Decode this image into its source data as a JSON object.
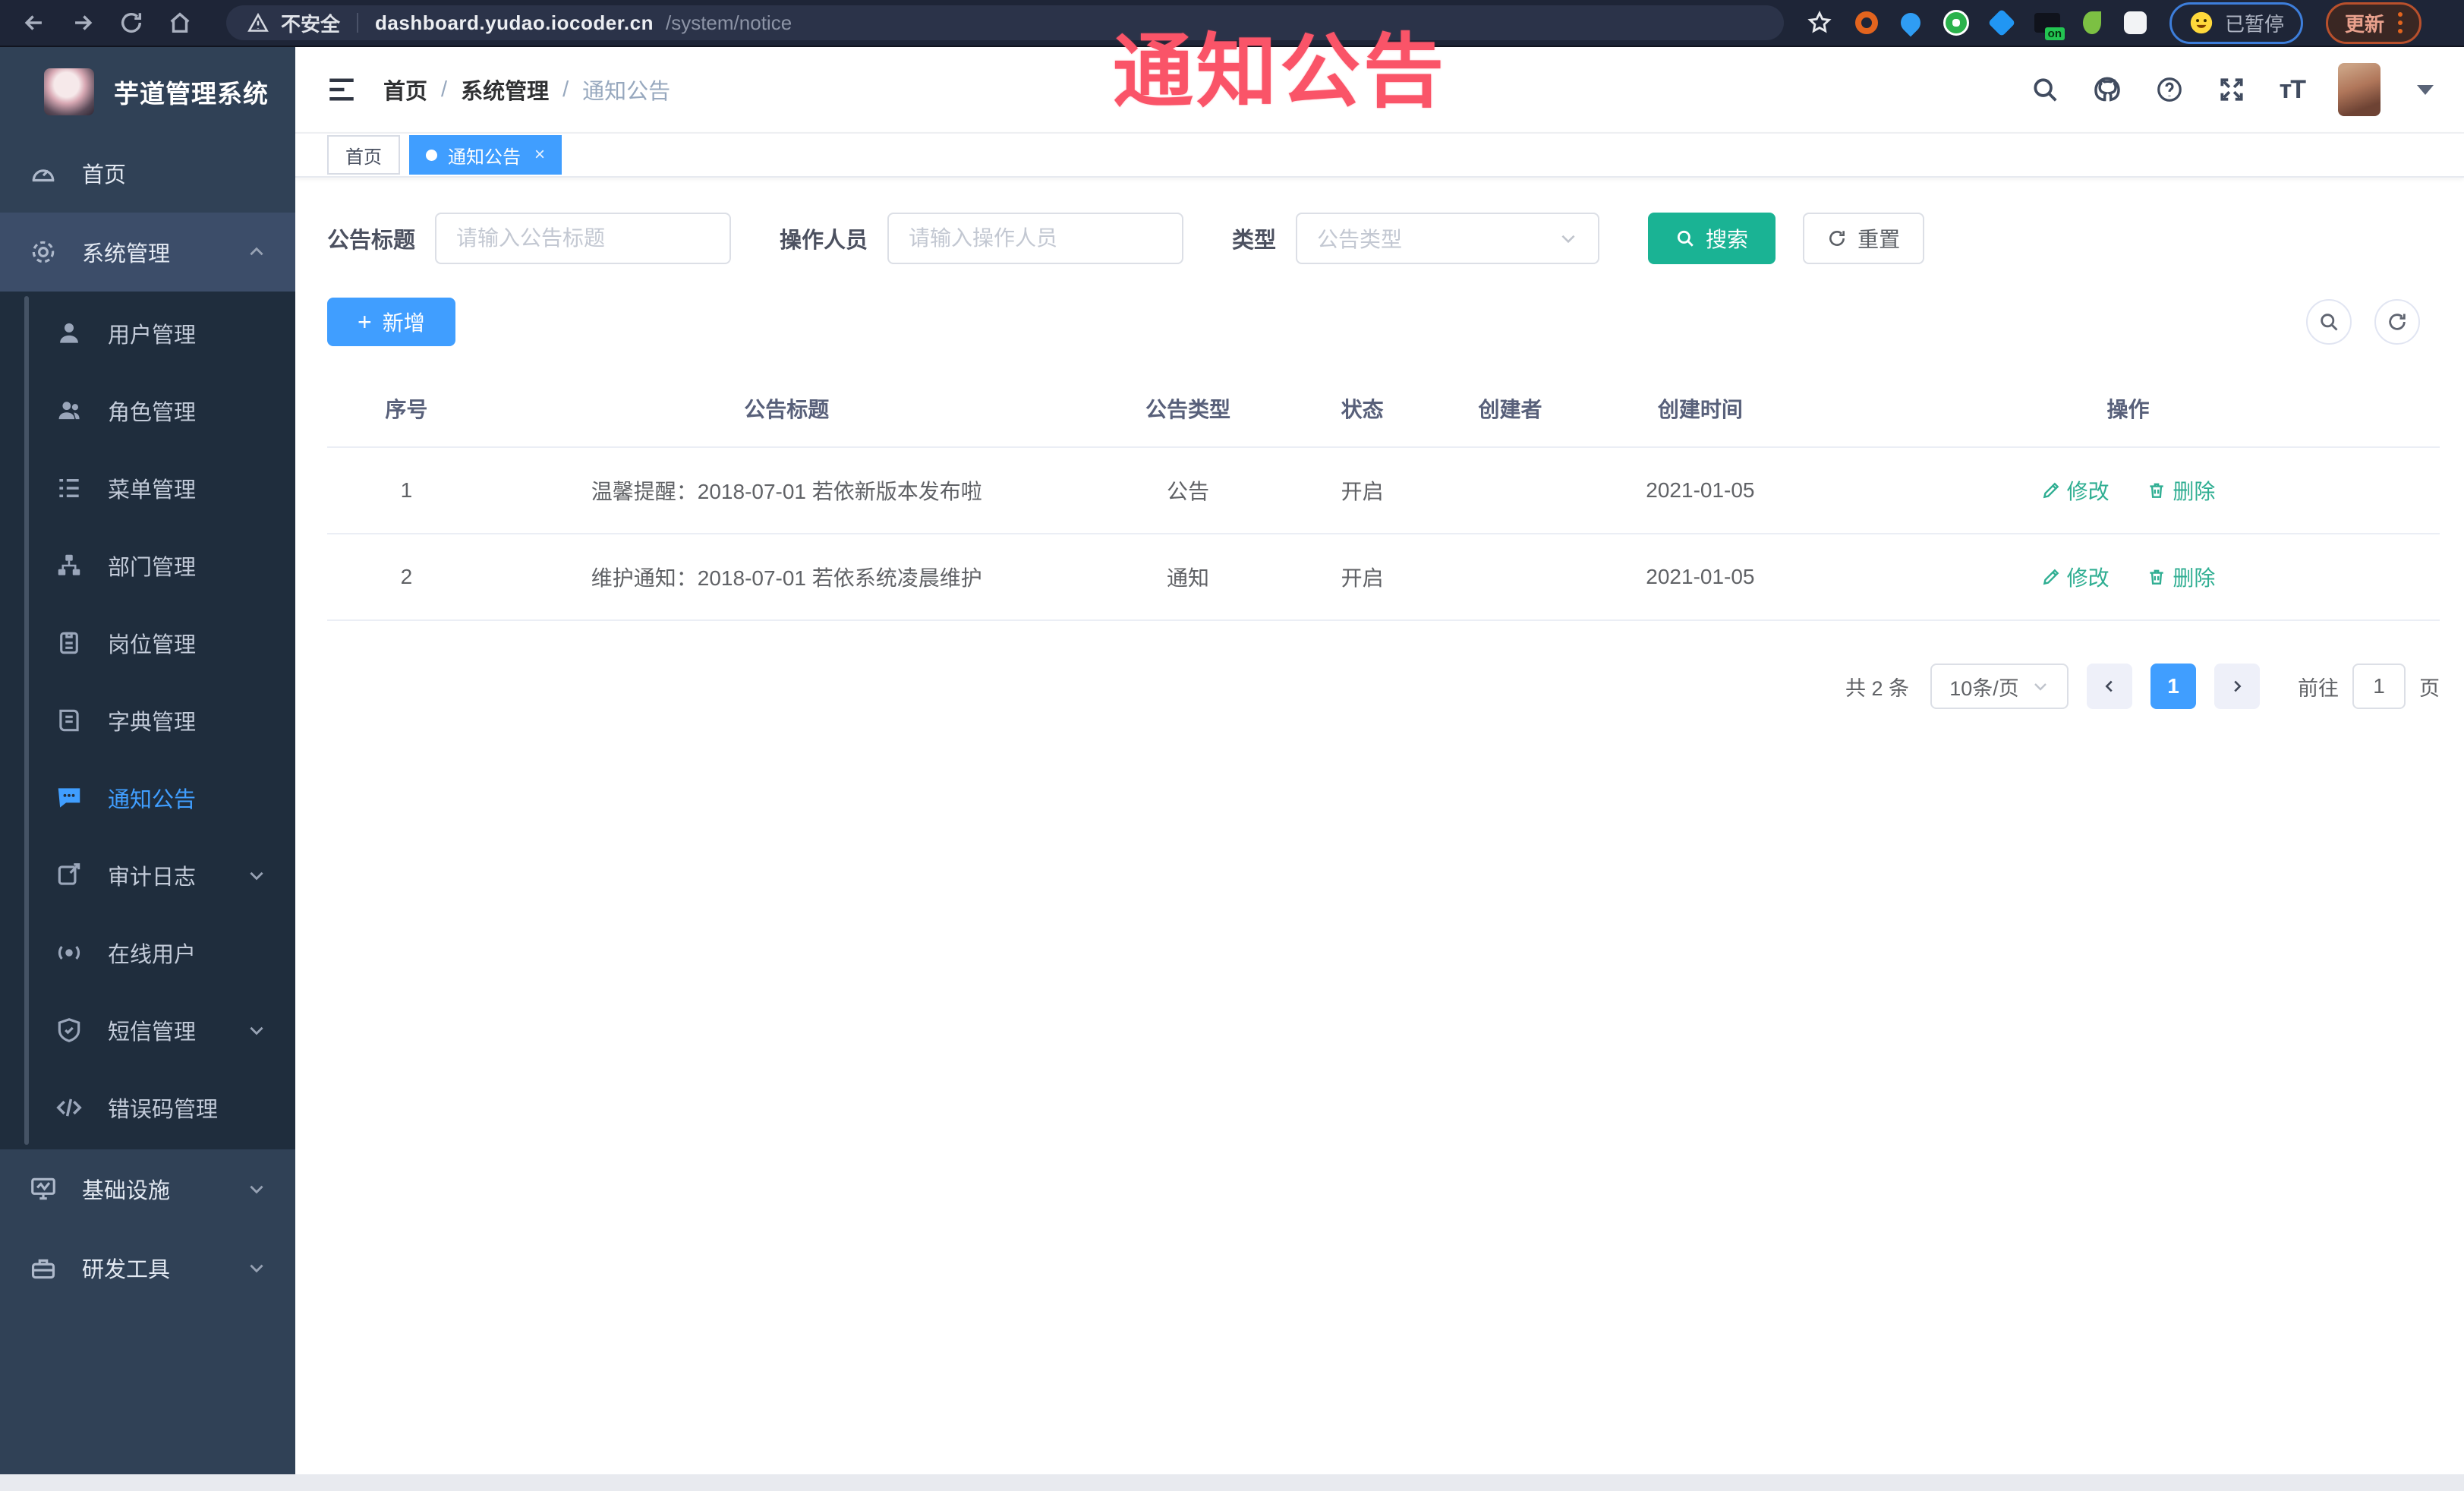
{
  "browser": {
    "security_label": "不安全",
    "url_host": "dashboard.yudao.iocoder.cn",
    "url_path": "/system/notice",
    "paused_chip_label": "已暂停",
    "update_button_label": "更新",
    "nav_icons": [
      "back-arrow",
      "forward-arrow",
      "reload",
      "home"
    ],
    "extension_icons": [
      "star",
      "orange-donut",
      "blue-pin",
      "green-circle",
      "blue-gem",
      "dark-stack-on",
      "green-sprout",
      "puzzle"
    ]
  },
  "watermark": "通知公告",
  "sidebar": {
    "title": "芋道管理系统",
    "items": [
      {
        "label": "首页",
        "icon": "dashboard-icon"
      },
      {
        "label": "系统管理",
        "icon": "gear-icon",
        "expanded": true
      },
      {
        "label": "用户管理",
        "icon": "user-icon"
      },
      {
        "label": "角色管理",
        "icon": "users-icon"
      },
      {
        "label": "菜单管理",
        "icon": "menu-list-icon"
      },
      {
        "label": "部门管理",
        "icon": "org-tree-icon"
      },
      {
        "label": "岗位管理",
        "icon": "badge-icon"
      },
      {
        "label": "字典管理",
        "icon": "book-icon"
      },
      {
        "label": "通知公告",
        "icon": "notice-icon",
        "active": true
      },
      {
        "label": "审计日志",
        "icon": "log-icon",
        "collapsible": true
      },
      {
        "label": "在线用户",
        "icon": "online-icon"
      },
      {
        "label": "短信管理",
        "icon": "shield-icon",
        "collapsible": true
      },
      {
        "label": "错误码管理",
        "icon": "code-icon"
      },
      {
        "label": "基础设施",
        "icon": "monitor-icon",
        "collapsible": true
      },
      {
        "label": "研发工具",
        "icon": "tools-icon",
        "collapsible": true
      }
    ]
  },
  "header": {
    "breadcrumb": [
      "首页",
      "系统管理",
      "通知公告"
    ],
    "separator": "/",
    "right_icons": [
      "search-icon",
      "github-icon",
      "help-icon",
      "fullscreen-icon",
      "font-size-icon"
    ],
    "font_size_glyph": "тT"
  },
  "tabs": [
    {
      "label": "首页",
      "active": false
    },
    {
      "label": "通知公告",
      "active": true,
      "close_glyph": "×"
    }
  ],
  "filters": {
    "title_label": "公告标题",
    "title_placeholder": "请输入公告标题",
    "operator_label": "操作人员",
    "operator_placeholder": "请输入操作人员",
    "type_label": "类型",
    "type_placeholder": "公告类型",
    "search_label": "搜索",
    "reset_label": "重置"
  },
  "toolbar": {
    "add_label": "新增",
    "plus_glyph": "+",
    "round_icons": [
      "search-icon",
      "refresh-icon"
    ]
  },
  "table": {
    "columns": [
      "序号",
      "公告标题",
      "公告类型",
      "状态",
      "创建者",
      "创建时间",
      "操作"
    ],
    "rows": [
      {
        "no": "1",
        "title": "温馨提醒：2018-07-01 若依新版本发布啦",
        "type": "公告",
        "status": "开启",
        "creator": "",
        "created": "2021-01-05"
      },
      {
        "no": "2",
        "title": "维护通知：2018-07-01 若依系统凌晨维护",
        "type": "通知",
        "status": "开启",
        "creator": "",
        "created": "2021-01-05"
      }
    ],
    "actions": {
      "edit": "修改",
      "delete": "删除"
    }
  },
  "pagination": {
    "total": "共 2 条",
    "page_size": "10条/页",
    "current_page": "1",
    "goto_label": "前往",
    "goto_value": "1",
    "page_unit": "页"
  },
  "colors": {
    "primary": "#409EFF",
    "search_teal": "#1AB394",
    "action_link": "#2fae92",
    "watermark_pink": "#fa5468",
    "sidebar_bg": "#304156",
    "submenu_bg": "#1f2d3d",
    "chrome_bg": "#1e2537"
  }
}
